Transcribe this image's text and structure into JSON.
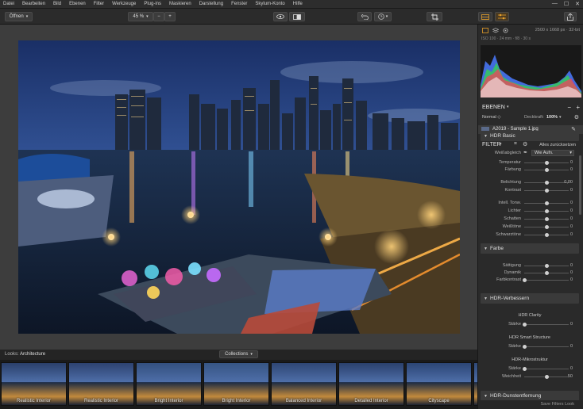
{
  "menu": [
    "Datei",
    "Bearbeiten",
    "Bild",
    "Ebenen",
    "Filter",
    "Werkzeuge",
    "Plug-ins",
    "Maskieren",
    "Darstellung",
    "Fenster",
    "Skylum-Konto",
    "Hilfe"
  ],
  "window_controls": [
    "—",
    "☐",
    "✕"
  ],
  "toolbar": {
    "open_label": "Öffnen",
    "zoom_value": "45 %",
    "zoom_out": "−",
    "zoom_in": "+"
  },
  "panel": {
    "image_info": "2500 x 1668 px · 32-bit",
    "camera_info": "ISO 100 · 24 mm · f/8 · 30 s",
    "layers_title": "EBENEN",
    "blend_mode": "Normal",
    "opacity_label": "Deckkraft:",
    "opacity_value": "100%",
    "layer_name": "A2019 - Sample 1.jpg",
    "filter_title": "FILTER",
    "reset_all": "Alles zurücksetzen",
    "sections": {
      "hdr_basic": "HDR Basic",
      "farbe": "Farbe",
      "hdr_verbessern": "HDR-Verbessern",
      "next": "HDR-Dunstentfernung"
    },
    "wb_label": "Weißabgleich",
    "wb_value": "Wie Aufn.",
    "controls_basic": [
      {
        "label": "Temperatur",
        "value": "0",
        "pos": 0.5
      },
      {
        "label": "Färbung",
        "value": "0",
        "pos": 0.5
      },
      {
        "label": "Belichtung",
        "value": "0,00",
        "pos": 0.5
      },
      {
        "label": "Kontrast",
        "value": "0",
        "pos": 0.5
      },
      {
        "label": "Intell. Tonw.",
        "value": "0",
        "pos": 0.5
      },
      {
        "label": "Lichter",
        "value": "0",
        "pos": 0.5
      },
      {
        "label": "Schatten",
        "value": "0",
        "pos": 0.5
      },
      {
        "label": "Weißtöne",
        "value": "0",
        "pos": 0.5
      },
      {
        "label": "Schwarztöne",
        "value": "0",
        "pos": 0.5
      }
    ],
    "controls_farbe": [
      {
        "label": "Sättigung",
        "value": "0",
        "pos": 0.5
      },
      {
        "label": "Dynamik",
        "value": "0",
        "pos": 0.5
      },
      {
        "label": "Farbkontrast",
        "value": "0",
        "pos": 0.0
      }
    ],
    "hdr_clarity_title": "HDR Clarity",
    "hdr_smart_title": "HDR Smart Structure",
    "hdr_micro_title": "HDR-Mikrostruktur",
    "controls_verbessern": [
      {
        "label": "Stärke",
        "value": "0",
        "pos": 0.0
      },
      {
        "label": "Stärke",
        "value": "0",
        "pos": 0.0
      },
      {
        "label": "Stärke",
        "value": "0",
        "pos": 0.0
      },
      {
        "label": "Weichheit",
        "value": "50",
        "pos": 0.5
      }
    ],
    "save_filters": "Save Filters Look"
  },
  "looks": {
    "label": "Looks:",
    "current": "Architecture",
    "collections_btn": "Collections"
  },
  "thumbnails": [
    "Realistic Interior",
    "Realistic Interior",
    "Bright Interior",
    "Bright Interior",
    "Balanced Interior",
    "Detailed Interior",
    "Cityscape",
    "A"
  ],
  "colors": {
    "accent": "#e8a02a",
    "panel_bg": "#2a2a2a",
    "section_bg": "#3a3a3a",
    "canvas_bg": "#3d3d3d"
  }
}
